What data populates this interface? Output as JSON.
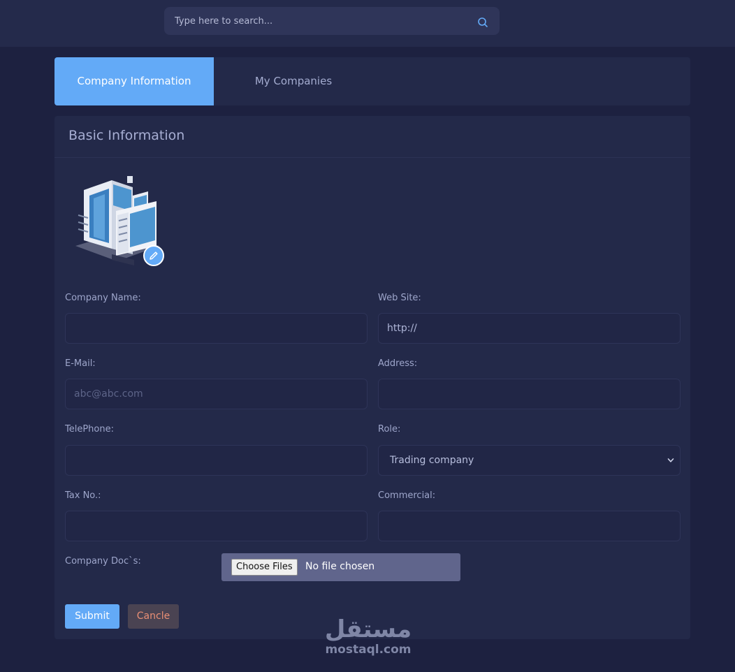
{
  "search": {
    "placeholder": "Type here to search..."
  },
  "tabs": [
    {
      "label": "Company Information",
      "active": true
    },
    {
      "label": "My Companies",
      "active": false
    }
  ],
  "card": {
    "title": "Basic Information"
  },
  "form": {
    "company_name": {
      "label": "Company Name:",
      "value": "",
      "placeholder": ""
    },
    "website": {
      "label": "Web Site:",
      "value": "http://"
    },
    "email": {
      "label": "E-Mail:",
      "value": "",
      "placeholder": "abc@abc.com"
    },
    "address": {
      "label": "Address:",
      "value": ""
    },
    "telephone": {
      "label": "TelePhone:",
      "value": ""
    },
    "role": {
      "label": "Role:",
      "selected": "Trading company"
    },
    "tax_no": {
      "label": "Tax No.:",
      "value": ""
    },
    "commercial": {
      "label": "Commercial:",
      "value": ""
    },
    "docs": {
      "label": "Company Doc`s:",
      "button": "Choose Files",
      "status": "No file chosen"
    }
  },
  "actions": {
    "submit": "Submit",
    "cancel": "Cancle"
  },
  "watermark": {
    "arabic": "مستقل",
    "latin": "mostaql.com"
  },
  "colors": {
    "accent": "#63aaf7",
    "background": "#1d2140",
    "panel": "#232949"
  }
}
